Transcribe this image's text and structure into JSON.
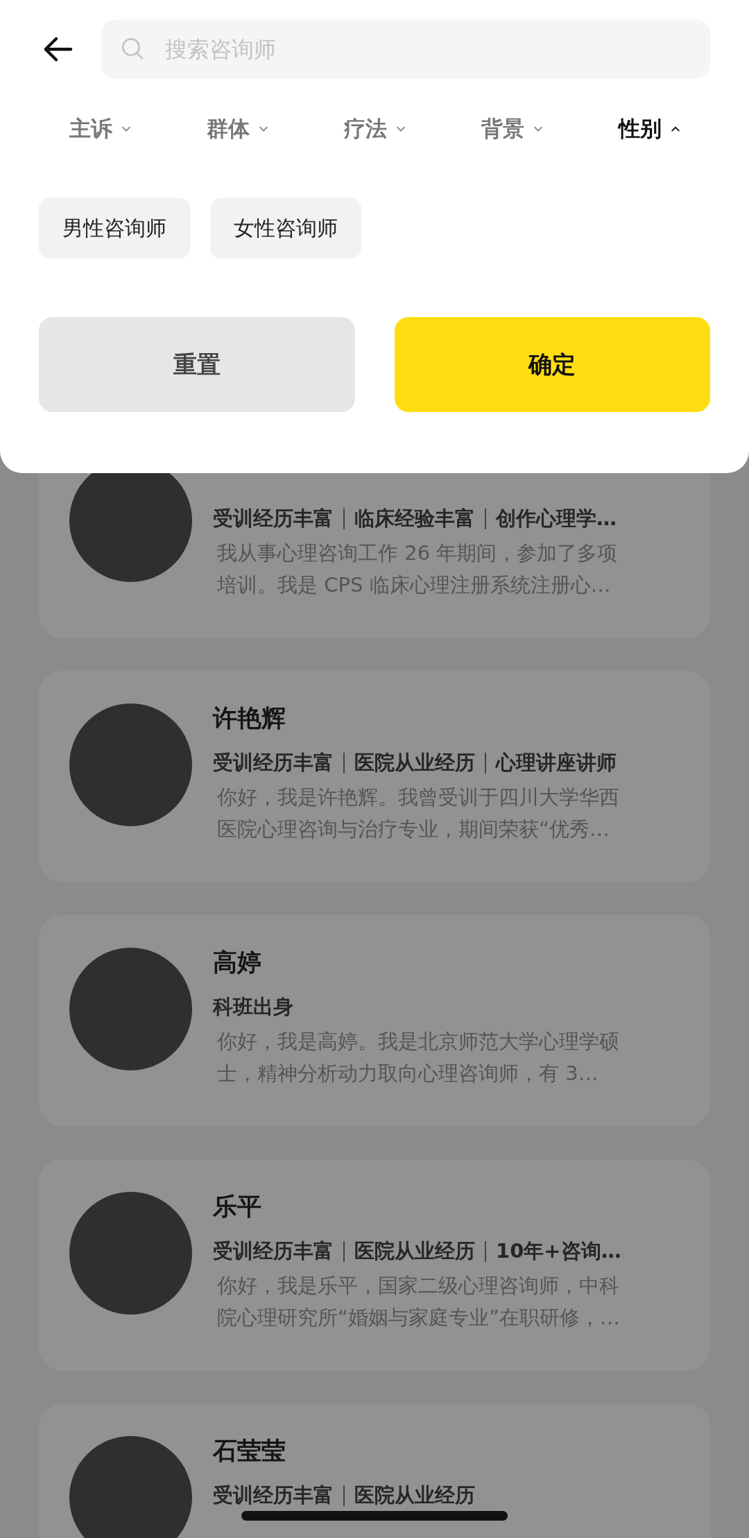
{
  "search": {
    "placeholder": "搜索咨询师"
  },
  "filter_tabs": [
    {
      "label": "主诉",
      "selected": false
    },
    {
      "label": "群体",
      "selected": false
    },
    {
      "label": "疗法",
      "selected": false
    },
    {
      "label": "背景",
      "selected": false
    },
    {
      "label": "性别",
      "selected": true
    }
  ],
  "options": [
    {
      "label": "男性咨询师",
      "selected": false
    },
    {
      "label": "女性咨询师",
      "selected": false
    }
  ],
  "buttons": {
    "reset": "重置",
    "confirm": "确定"
  },
  "counselors": [
    {
      "tags": [
        "受训经历丰富",
        "临床经验丰富",
        "创作心理学…"
      ],
      "desc_lines": [
        "我从事心理咨询工作 26 年期间，参加了多项",
        "培训。我是 CPS 临床心理注册系统注册心…"
      ]
    },
    {
      "name": "许艳辉",
      "tags": [
        "受训经历丰富",
        "医院从业经历",
        "心理讲座讲师"
      ],
      "desc_lines": [
        "你好，我是许艳辉。我曾受训于四川大学华西",
        "医院心理咨询与治疗专业，期间荣获“优秀…"
      ]
    },
    {
      "name": "高婷",
      "tags": [
        "科班出身"
      ],
      "desc_lines": [
        "你好，我是高婷。我是北京师范大学心理学硕",
        "士，精神分析动力取向心理咨询师，有 3…"
      ]
    },
    {
      "name": "乐平",
      "tags": [
        "受训经历丰富",
        "医院从业经历",
        "10年+咨询…"
      ],
      "desc_lines": [
        "你好，我是乐平，国家二级心理咨询师，中科",
        "院心理研究所“婚姻与家庭专业”在职研修，…"
      ]
    },
    {
      "name": "石莹莹",
      "tags": [
        "受训经历丰富",
        "医院从业经历"
      ]
    }
  ]
}
